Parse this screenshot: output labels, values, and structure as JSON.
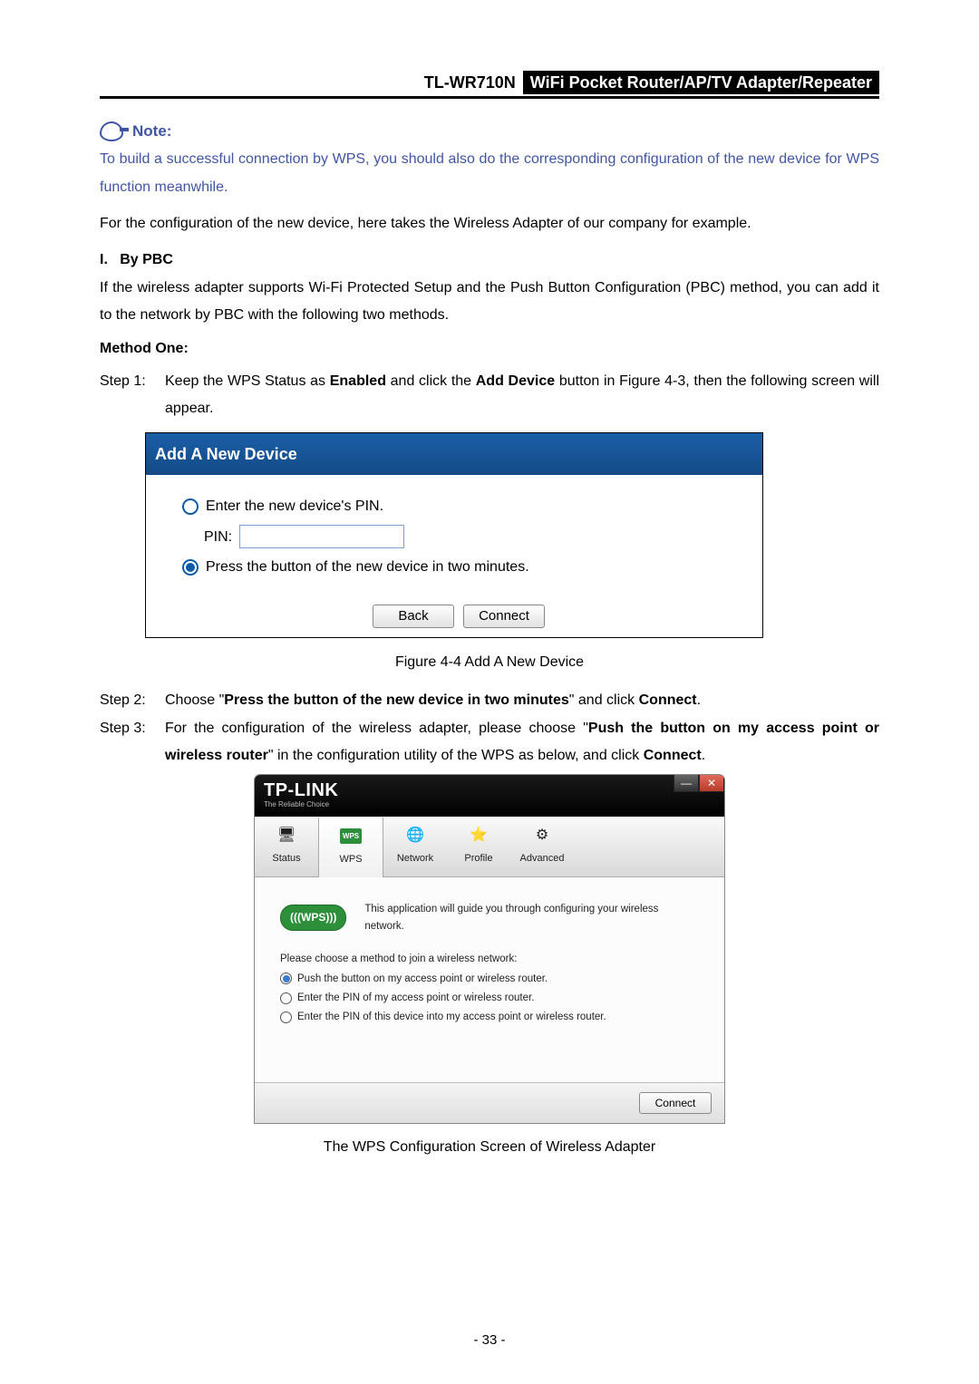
{
  "header": {
    "model": "TL-WR710N",
    "subtitle": "WiFi  Pocket  Router/AP/TV  Adapter/Repeater"
  },
  "note": {
    "label": "Note:",
    "body": "To build a successful connection by WPS, you should also do the corresponding configuration of the new device for WPS function meanwhile."
  },
  "para_config": "For the configuration of the new device, here takes the Wireless Adapter of our company for example.",
  "section_pbc": {
    "num": "I.",
    "title": "By PBC"
  },
  "para_pbc": "If the wireless adapter supports Wi-Fi Protected Setup and the Push Button Configuration (PBC) method, you can add it to the network by PBC with the following two methods.",
  "method_one": "Method One:",
  "step1": {
    "label": "Step 1:",
    "pre": "Keep the WPS Status as ",
    "b1": "Enabled",
    "mid": " and click the ",
    "b2": "Add Device",
    "post": " button in Figure 4-3, then the following screen will appear."
  },
  "fig44": {
    "title": "Add A New Device",
    "opt_pin": "Enter the new device's PIN.",
    "pin_label": "PIN:",
    "opt_press": "Press the button of the new device in two minutes.",
    "btn_back": "Back",
    "btn_connect": "Connect",
    "caption": "Figure 4-4    Add A New Device"
  },
  "step2": {
    "label": "Step 2:",
    "pre": "Choose \"",
    "b": "Press the button of the new device in two minutes",
    "mid": "\" and click ",
    "b2": "Connect",
    "post": "."
  },
  "step3": {
    "label": "Step 3:",
    "pre": "For the configuration of the wireless adapter, please choose \"",
    "b": "Push the button on my access point or wireless router",
    "mid": "\" in the configuration utility of the WPS as below, and click ",
    "b2": "Connect",
    "post": "."
  },
  "tplink": {
    "brand": "TP-LINK",
    "tagline": "The Reliable Choice",
    "tabs": {
      "status": "Status",
      "wps": "WPS",
      "network": "Network",
      "profile": "Profile",
      "advanced": "Advanced"
    },
    "wps_pill": "(((WPS)))",
    "intro": "This application will guide you through configuring your wireless network.",
    "choose": "Please choose a method to join a wireless network:",
    "opt1": "Push the button on my access point or wireless router.",
    "opt2": "Enter the PIN of my access point or wireless router.",
    "opt3": "Enter the PIN of this device into my access point or wireless router.",
    "connect": "Connect"
  },
  "wps_caption": "The WPS Configuration Screen of Wireless Adapter",
  "page_number": "- 33 -"
}
